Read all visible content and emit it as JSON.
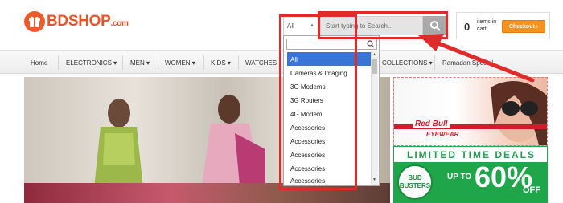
{
  "logo": {
    "text": "BDSHOP",
    "suffix": ".com"
  },
  "search": {
    "category_selected": "All",
    "placeholder": "Start typing to Search..."
  },
  "cart": {
    "count": "0",
    "label": "items in cart.",
    "checkout": "Checkout ›"
  },
  "nav": {
    "items": [
      {
        "label": "Home"
      },
      {
        "label": "ELECTRONICS ▾"
      },
      {
        "label": "MEN ▾"
      },
      {
        "label": "WOMEN ▾"
      },
      {
        "label": "KIDS ▾"
      },
      {
        "label": "WATCHES"
      },
      {
        "label": "COLLECTIONS ▾"
      },
      {
        "label": "Ramadan Special"
      }
    ]
  },
  "dropdown": {
    "items": [
      {
        "label": "All",
        "selected": true
      },
      {
        "label": "Cameras & Imaging"
      },
      {
        "label": "3G Modems"
      },
      {
        "label": "3G Routers"
      },
      {
        "label": "4G Modem"
      },
      {
        "label": "Accessories"
      },
      {
        "label": "Accessories"
      },
      {
        "label": "Accessories"
      },
      {
        "label": "Accessories"
      },
      {
        "label": "Accessories"
      }
    ]
  },
  "ads": {
    "redbull": {
      "title": "Red Bull",
      "racing": "racing",
      "sub": "EYEWEAR"
    },
    "limited": {
      "title": "LIMITED TIME DEALS",
      "badge": "BUD BUSTERS",
      "upto": "UP TO",
      "percent": "60%",
      "off": "OFF"
    }
  },
  "colors": {
    "brand": "#e8542a",
    "checkout": "#f7921e",
    "highlight": "#e02b2b",
    "selected": "#3875d7",
    "deals_green": "#1fa64a"
  },
  "icons": [
    "gift-icon",
    "search-icon",
    "dropdown-arrow-icon"
  ]
}
